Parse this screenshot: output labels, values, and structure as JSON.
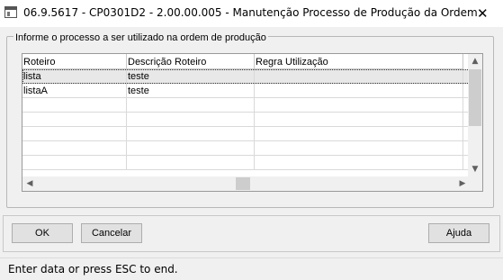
{
  "window": {
    "title": "06.9.5617 - CP0301D2 - 2.00.00.005 - Manutenção Processo de Produção da Ordem",
    "close_glyph": "✕"
  },
  "group": {
    "label": "Informe o processo a ser utilizado na ordem de produção"
  },
  "grid": {
    "columns": [
      "Roteiro",
      "Descrição Roteiro",
      "Regra Utilização"
    ],
    "rows": [
      {
        "roteiro": "lista",
        "descricao": "teste",
        "regra": ""
      },
      {
        "roteiro": "listaA",
        "descricao": "teste",
        "regra": ""
      }
    ],
    "scroll": {
      "up": "▲",
      "down": "▼",
      "left": "◀",
      "right": "▶"
    }
  },
  "buttons": {
    "ok": "OK",
    "cancel": "Cancelar",
    "help": "Ajuda"
  },
  "status": {
    "text": "Enter data or press ESC to end."
  },
  "icons": {
    "window": "app-window-icon",
    "close": "close-icon"
  }
}
